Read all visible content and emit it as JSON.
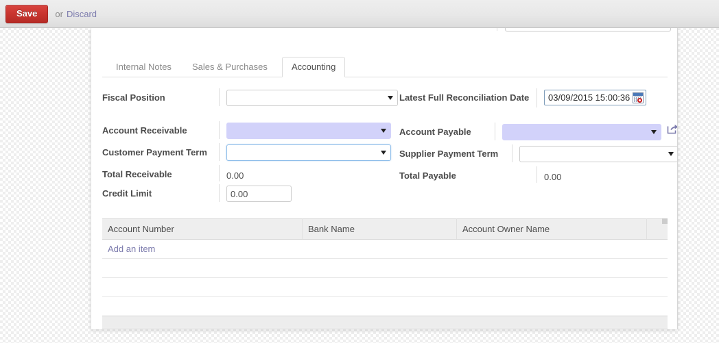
{
  "topbar": {
    "save_label": "Save",
    "or_label": "or",
    "discard_label": "Discard",
    "save_color": "#c8352f",
    "link_color": "#7c7bad"
  },
  "tabs": [
    {
      "label": "Internal Notes",
      "active": false
    },
    {
      "label": "Sales & Purchases",
      "active": false
    },
    {
      "label": "Accounting",
      "active": true
    }
  ],
  "form": {
    "left": {
      "fiscal_position": {
        "label": "Fiscal Position",
        "value": "",
        "type": "select"
      },
      "account_receivable": {
        "label": "Account Receivable",
        "value": "",
        "type": "select",
        "required": true,
        "required_color": "#d2d2fa"
      },
      "customer_payment_term": {
        "label": "Customer Payment Term",
        "value": "",
        "type": "select",
        "focused": true,
        "focus_color": "#8dbdea"
      },
      "total_receivable": {
        "label": "Total Receivable",
        "value": "0.00",
        "type": "readonly"
      },
      "credit_limit": {
        "label": "Credit Limit",
        "value": "0.00",
        "type": "input"
      }
    },
    "right": {
      "latest_reconciliation": {
        "label": "Latest Full Reconciliation Date",
        "value": "03/09/2015 15:00:36",
        "type": "datetime",
        "icon": "calendar-icon"
      },
      "account_payable": {
        "label": "Account Payable",
        "value": "",
        "type": "select",
        "required": true,
        "icon": "external-link-icon"
      },
      "supplier_payment_term": {
        "label": "Supplier Payment Term",
        "value": "",
        "type": "select"
      },
      "total_payable": {
        "label": "Total Payable",
        "value": "0.00",
        "type": "readonly"
      }
    }
  },
  "bank_accounts": {
    "columns": [
      "Account Number",
      "Bank Name",
      "Account Owner Name"
    ],
    "rows": [],
    "add_item_label": "Add an item",
    "empty_row_count": 3
  }
}
